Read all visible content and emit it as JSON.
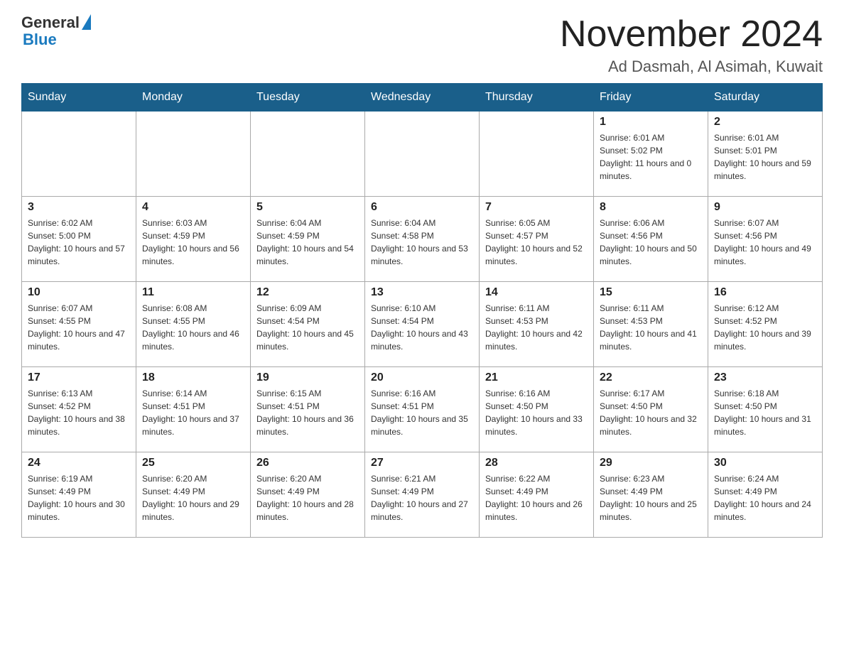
{
  "header": {
    "logo_general": "General",
    "logo_blue": "Blue",
    "title": "November 2024",
    "subtitle": "Ad Dasmah, Al Asimah, Kuwait"
  },
  "weekdays": [
    "Sunday",
    "Monday",
    "Tuesday",
    "Wednesday",
    "Thursday",
    "Friday",
    "Saturday"
  ],
  "weeks": [
    [
      {
        "day": "",
        "info": ""
      },
      {
        "day": "",
        "info": ""
      },
      {
        "day": "",
        "info": ""
      },
      {
        "day": "",
        "info": ""
      },
      {
        "day": "",
        "info": ""
      },
      {
        "day": "1",
        "info": "Sunrise: 6:01 AM\nSunset: 5:02 PM\nDaylight: 11 hours and 0 minutes."
      },
      {
        "day": "2",
        "info": "Sunrise: 6:01 AM\nSunset: 5:01 PM\nDaylight: 10 hours and 59 minutes."
      }
    ],
    [
      {
        "day": "3",
        "info": "Sunrise: 6:02 AM\nSunset: 5:00 PM\nDaylight: 10 hours and 57 minutes."
      },
      {
        "day": "4",
        "info": "Sunrise: 6:03 AM\nSunset: 4:59 PM\nDaylight: 10 hours and 56 minutes."
      },
      {
        "day": "5",
        "info": "Sunrise: 6:04 AM\nSunset: 4:59 PM\nDaylight: 10 hours and 54 minutes."
      },
      {
        "day": "6",
        "info": "Sunrise: 6:04 AM\nSunset: 4:58 PM\nDaylight: 10 hours and 53 minutes."
      },
      {
        "day": "7",
        "info": "Sunrise: 6:05 AM\nSunset: 4:57 PM\nDaylight: 10 hours and 52 minutes."
      },
      {
        "day": "8",
        "info": "Sunrise: 6:06 AM\nSunset: 4:56 PM\nDaylight: 10 hours and 50 minutes."
      },
      {
        "day": "9",
        "info": "Sunrise: 6:07 AM\nSunset: 4:56 PM\nDaylight: 10 hours and 49 minutes."
      }
    ],
    [
      {
        "day": "10",
        "info": "Sunrise: 6:07 AM\nSunset: 4:55 PM\nDaylight: 10 hours and 47 minutes."
      },
      {
        "day": "11",
        "info": "Sunrise: 6:08 AM\nSunset: 4:55 PM\nDaylight: 10 hours and 46 minutes."
      },
      {
        "day": "12",
        "info": "Sunrise: 6:09 AM\nSunset: 4:54 PM\nDaylight: 10 hours and 45 minutes."
      },
      {
        "day": "13",
        "info": "Sunrise: 6:10 AM\nSunset: 4:54 PM\nDaylight: 10 hours and 43 minutes."
      },
      {
        "day": "14",
        "info": "Sunrise: 6:11 AM\nSunset: 4:53 PM\nDaylight: 10 hours and 42 minutes."
      },
      {
        "day": "15",
        "info": "Sunrise: 6:11 AM\nSunset: 4:53 PM\nDaylight: 10 hours and 41 minutes."
      },
      {
        "day": "16",
        "info": "Sunrise: 6:12 AM\nSunset: 4:52 PM\nDaylight: 10 hours and 39 minutes."
      }
    ],
    [
      {
        "day": "17",
        "info": "Sunrise: 6:13 AM\nSunset: 4:52 PM\nDaylight: 10 hours and 38 minutes."
      },
      {
        "day": "18",
        "info": "Sunrise: 6:14 AM\nSunset: 4:51 PM\nDaylight: 10 hours and 37 minutes."
      },
      {
        "day": "19",
        "info": "Sunrise: 6:15 AM\nSunset: 4:51 PM\nDaylight: 10 hours and 36 minutes."
      },
      {
        "day": "20",
        "info": "Sunrise: 6:16 AM\nSunset: 4:51 PM\nDaylight: 10 hours and 35 minutes."
      },
      {
        "day": "21",
        "info": "Sunrise: 6:16 AM\nSunset: 4:50 PM\nDaylight: 10 hours and 33 minutes."
      },
      {
        "day": "22",
        "info": "Sunrise: 6:17 AM\nSunset: 4:50 PM\nDaylight: 10 hours and 32 minutes."
      },
      {
        "day": "23",
        "info": "Sunrise: 6:18 AM\nSunset: 4:50 PM\nDaylight: 10 hours and 31 minutes."
      }
    ],
    [
      {
        "day": "24",
        "info": "Sunrise: 6:19 AM\nSunset: 4:49 PM\nDaylight: 10 hours and 30 minutes."
      },
      {
        "day": "25",
        "info": "Sunrise: 6:20 AM\nSunset: 4:49 PM\nDaylight: 10 hours and 29 minutes."
      },
      {
        "day": "26",
        "info": "Sunrise: 6:20 AM\nSunset: 4:49 PM\nDaylight: 10 hours and 28 minutes."
      },
      {
        "day": "27",
        "info": "Sunrise: 6:21 AM\nSunset: 4:49 PM\nDaylight: 10 hours and 27 minutes."
      },
      {
        "day": "28",
        "info": "Sunrise: 6:22 AM\nSunset: 4:49 PM\nDaylight: 10 hours and 26 minutes."
      },
      {
        "day": "29",
        "info": "Sunrise: 6:23 AM\nSunset: 4:49 PM\nDaylight: 10 hours and 25 minutes."
      },
      {
        "day": "30",
        "info": "Sunrise: 6:24 AM\nSunset: 4:49 PM\nDaylight: 10 hours and 24 minutes."
      }
    ]
  ]
}
